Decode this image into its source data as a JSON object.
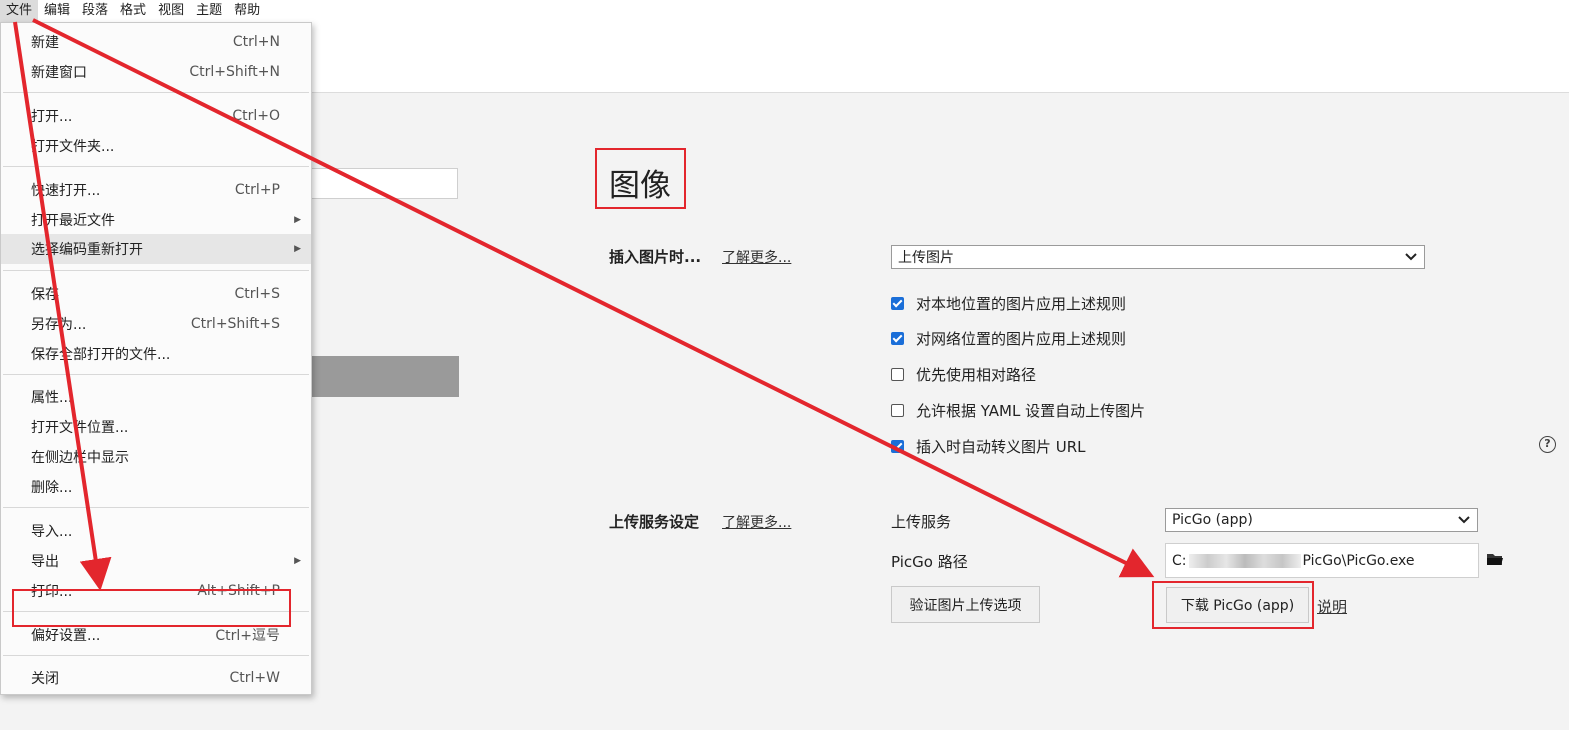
{
  "menubar": [
    "文件",
    "编辑",
    "段落",
    "格式",
    "视图",
    "主题",
    "帮助"
  ],
  "file_menu": {
    "new": {
      "label": "新建",
      "shortcut": "Ctrl+N"
    },
    "new_window": {
      "label": "新建窗口",
      "shortcut": "Ctrl+Shift+N"
    },
    "open": {
      "label": "打开...",
      "shortcut": "Ctrl+O"
    },
    "open_folder": {
      "label": "打开文件夹..."
    },
    "quick_open": {
      "label": "快速打开...",
      "shortcut": "Ctrl+P"
    },
    "open_recent": {
      "label": "打开最近文件"
    },
    "reopen_encoding": {
      "label": "选择编码重新打开"
    },
    "save": {
      "label": "保存",
      "shortcut": "Ctrl+S"
    },
    "save_as": {
      "label": "另存为...",
      "shortcut": "Ctrl+Shift+S"
    },
    "save_all": {
      "label": "保存全部打开的文件..."
    },
    "properties": {
      "label": "属性..."
    },
    "open_location": {
      "label": "打开文件位置..."
    },
    "show_in_sidebar": {
      "label": "在侧边栏中显示"
    },
    "delete": {
      "label": "删除..."
    },
    "import": {
      "label": "导入..."
    },
    "export": {
      "label": "导出"
    },
    "print": {
      "label": "打印...",
      "shortcut": "Alt+Shift+P"
    },
    "preferences": {
      "label": "偏好设置...",
      "shortcut": "Ctrl+逗号"
    },
    "close": {
      "label": "关闭",
      "shortcut": "Ctrl+W"
    }
  },
  "image_section": {
    "title": "图像",
    "insert_label": "插入图片时...",
    "learn_more": "了解更多...",
    "insert_select_value": "上传图片",
    "options": [
      {
        "label": "对本地位置的图片应用上述规则",
        "checked": true
      },
      {
        "label": "对网络位置的图片应用上述规则",
        "checked": true
      },
      {
        "label": "优先使用相对路径",
        "checked": false
      },
      {
        "label": "允许根据 YAML 设置自动上传图片",
        "checked": false
      },
      {
        "label": "插入时自动转义图片 URL",
        "checked": true
      }
    ],
    "help_icon": "?"
  },
  "upload_section": {
    "title": "上传服务设定",
    "learn_more": "了解更多...",
    "service_label": "上传服务",
    "service_value": "PicGo (app)",
    "path_label": "PicGo 路径",
    "path_prefix": "C:",
    "path_suffix": "PicGo\\PicGo.exe",
    "verify_button": "验证图片上传选项",
    "download_button": "下载 PicGo (app)",
    "explain_link": "说明"
  },
  "colors": {
    "accent_red": "#e3262d",
    "checkbox_blue": "#1a6ed8"
  }
}
